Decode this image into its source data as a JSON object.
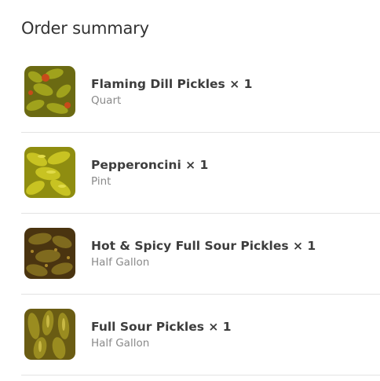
{
  "order_summary": {
    "title": "Order summary",
    "items": [
      {
        "name": "Flaming Dill Pickles",
        "quantity_label": "× 1",
        "variant": "Quart",
        "thumbnail_icon": "pickle-jar-photo",
        "colors": {
          "base": "#6b6a12",
          "accent": "#a0a21c",
          "highlight": "#c84a1a"
        }
      },
      {
        "name": "Pepperoncini",
        "quantity_label": "× 1",
        "variant": "Pint",
        "thumbnail_icon": "pepperoncini-photo",
        "colors": {
          "base": "#8f8d10",
          "accent": "#c8c322",
          "highlight": "#e1db4a"
        }
      },
      {
        "name": "Hot & Spicy Full Sour Pickles",
        "quantity_label": "× 1",
        "variant": "Half Gallon",
        "thumbnail_icon": "spicy-pickles-photo",
        "colors": {
          "base": "#4a3410",
          "accent": "#7f6a1e",
          "highlight": "#a9872b"
        }
      },
      {
        "name": "Full Sour Pickles",
        "quantity_label": "× 1",
        "variant": "Half Gallon",
        "thumbnail_icon": "sour-pickles-photo",
        "colors": {
          "base": "#6a5c13",
          "accent": "#9a8c20",
          "highlight": "#c9b944"
        }
      }
    ]
  }
}
